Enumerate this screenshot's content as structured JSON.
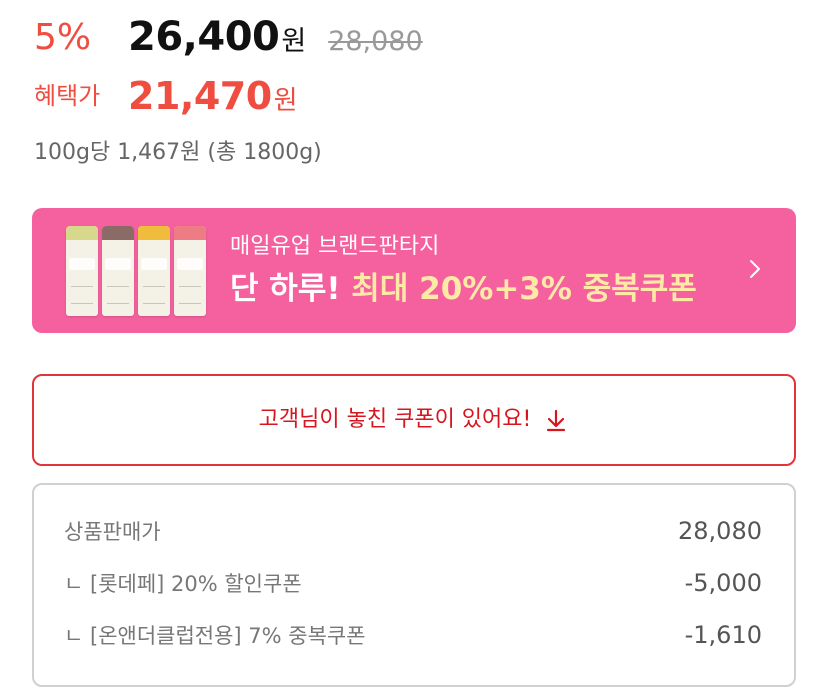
{
  "price": {
    "discount_rate": "5%",
    "sale_price": "26,400",
    "currency_unit": "원",
    "original_price": "28,080",
    "benefit_label": "혜택가",
    "benefit_price": "21,470",
    "unit_price_text": "100g당 1,467원 (총 1800g)"
  },
  "promo_banner": {
    "subtitle": "매일유업 브랜드판타지",
    "title_part1": "단 하루! ",
    "title_part2": "최대 20%+3% 중복쿠폰",
    "chevron_icon": "chevron-right-icon",
    "background_color": "#f5619f",
    "highlight_color": "#ffe9a6"
  },
  "coupon_button": {
    "label": "고객님이 놓친 쿠폰이 있어요!",
    "icon": "download-icon",
    "color": "#e3343c"
  },
  "breakdown": {
    "rows": [
      {
        "label": "상품판매가",
        "value": "28,080"
      },
      {
        "label": "ㄴ [롯데페] 20% 할인쿠폰",
        "value": "-5,000"
      },
      {
        "label": "ㄴ [온앤더클럽전용] 7% 중복쿠폰",
        "value": "-1,610"
      }
    ]
  },
  "colors": {
    "accent_red": "#ef4d40",
    "text_dark": "#111111",
    "text_muted": "#777777"
  }
}
